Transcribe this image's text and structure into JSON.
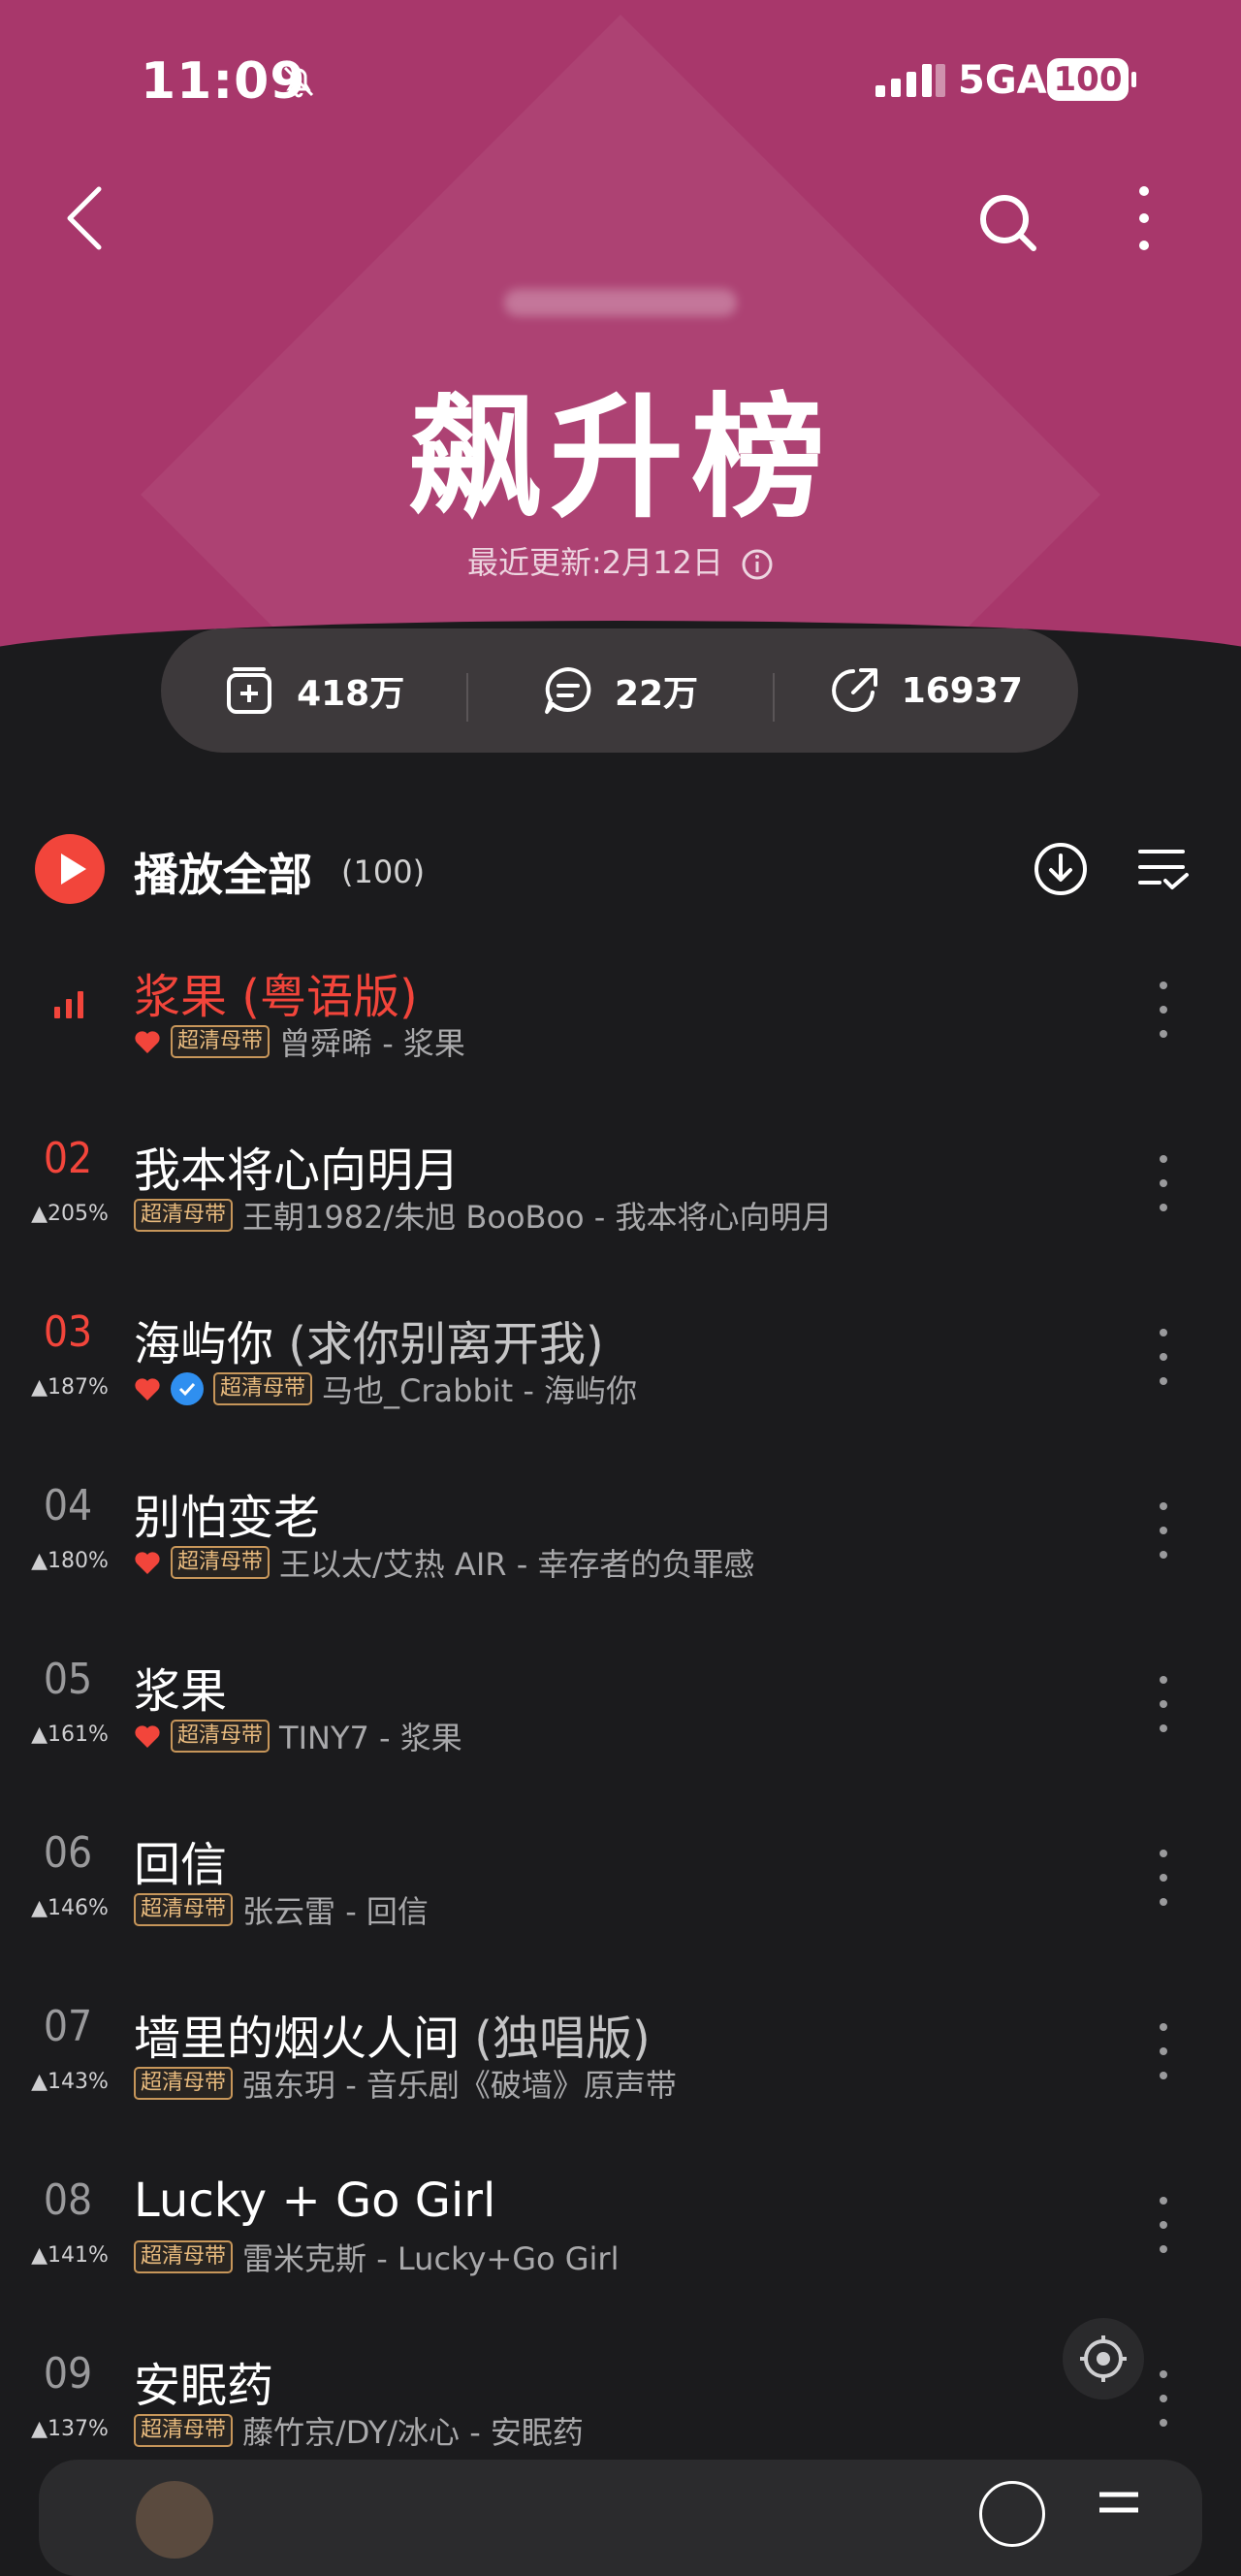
{
  "status_bar": {
    "time": "11:09",
    "network": "5GA",
    "battery": "100"
  },
  "header": {
    "title": "飙升榜",
    "update_text": "最近更新:2月12日"
  },
  "stats": {
    "collect": "418万",
    "comment": "22万",
    "share": "16937"
  },
  "play_all": {
    "label": "播放全部",
    "count": "(100)"
  },
  "songs": [
    {
      "rank": "",
      "change": "",
      "title": "浆果",
      "extra": " (粤语版)",
      "heart": true,
      "verified": false,
      "badge": "超清母带",
      "meta": "曾舜晞 - 浆果",
      "playing": true
    },
    {
      "rank": "02",
      "change": "▲205%",
      "title": "我本将心向明月",
      "extra": "",
      "heart": false,
      "verified": false,
      "badge": "超清母带",
      "meta": "王朝1982/朱旭 BooBoo - 我本将心向明月",
      "playing": false
    },
    {
      "rank": "03",
      "change": "▲187%",
      "title": "海屿你",
      "extra": " (求你别离开我)",
      "heart": true,
      "verified": true,
      "badge": "超清母带",
      "meta": "马也_Crabbit - 海屿你",
      "playing": false
    },
    {
      "rank": "04",
      "change": "▲180%",
      "title": "别怕变老",
      "extra": "",
      "heart": true,
      "verified": false,
      "badge": "超清母带",
      "meta": "王以太/艾热 AIR - 幸存者的负罪感",
      "playing": false
    },
    {
      "rank": "05",
      "change": "▲161%",
      "title": "浆果",
      "extra": "",
      "heart": true,
      "verified": false,
      "badge": "超清母带",
      "meta": "TINY7 - 浆果",
      "playing": false
    },
    {
      "rank": "06",
      "change": "▲146%",
      "title": "回信",
      "extra": "",
      "heart": false,
      "verified": false,
      "badge": "超清母带",
      "meta": "张云雷 - 回信",
      "playing": false
    },
    {
      "rank": "07",
      "change": "▲143%",
      "title": "墙里的烟火人间",
      "extra": " (独唱版)",
      "heart": false,
      "verified": false,
      "badge": "超清母带",
      "meta": "强东玥 - 音乐剧《破墙》原声带",
      "playing": false
    },
    {
      "rank": "08",
      "change": "▲141%",
      "title": "Lucky + Go Girl",
      "extra": "",
      "heart": false,
      "verified": false,
      "badge": "超清母带",
      "meta": "雷米克斯 - Lucky+Go Girl",
      "playing": false
    },
    {
      "rank": "09",
      "change": "▲137%",
      "title": "安眠药",
      "extra": "",
      "heart": false,
      "verified": false,
      "badge": "超清母带",
      "meta": "藤竹京/DY/冰心 - 安眠药",
      "playing": false
    }
  ],
  "colors": {
    "header": "#a8376b",
    "accent": "#f2453b",
    "background": "#1b1b1d",
    "badge": "#c7965a"
  },
  "icons": [
    "back-arrow-icon",
    "search-icon",
    "more-vertical-icon",
    "info-icon",
    "add-collection-icon",
    "comment-icon",
    "share-icon",
    "play-icon",
    "download-icon",
    "multiselect-icon",
    "heart-icon",
    "verified-icon",
    "more-icon"
  ]
}
